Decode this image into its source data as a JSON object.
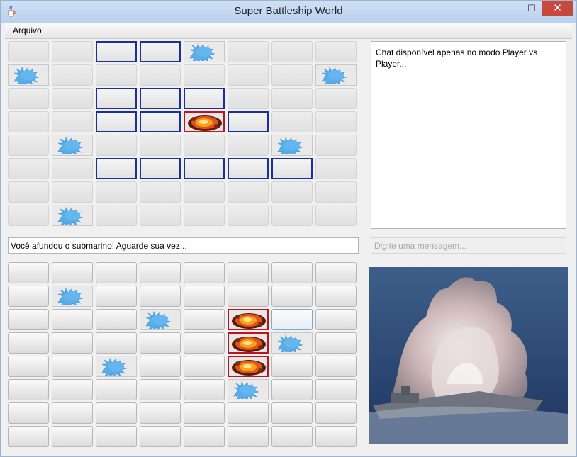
{
  "window": {
    "title": "Super Battleship World",
    "min_label": "—",
    "max_label": "☐",
    "close_label": "✕"
  },
  "menu": {
    "arquivo": "Arquivo"
  },
  "boards": [
    {
      "name": "enemy-board",
      "rows": [
        [
          "disabled",
          "disabled",
          "ship",
          "ship",
          "miss",
          "disabled",
          "disabled",
          "disabled"
        ],
        [
          "miss",
          "disabled",
          "disabled",
          "disabled",
          "disabled",
          "disabled",
          "disabled",
          "miss"
        ],
        [
          "disabled",
          "disabled",
          "ship",
          "ship",
          "ship",
          "disabled",
          "disabled",
          "disabled"
        ],
        [
          "disabled",
          "disabled",
          "ship",
          "ship",
          "hit",
          "ship",
          "disabled",
          "disabled"
        ],
        [
          "disabled",
          "miss",
          "disabled",
          "disabled",
          "disabled",
          "disabled",
          "miss",
          "disabled"
        ],
        [
          "disabled",
          "disabled",
          "ship",
          "ship",
          "ship",
          "ship",
          "ship",
          "disabled"
        ],
        [
          "disabled",
          "disabled",
          "disabled",
          "disabled",
          "disabled",
          "disabled",
          "disabled",
          "disabled"
        ],
        [
          "disabled",
          "miss",
          "disabled",
          "disabled",
          "disabled",
          "disabled",
          "disabled",
          "disabled"
        ]
      ]
    },
    {
      "name": "player-board",
      "rows": [
        [
          "empty",
          "empty",
          "empty",
          "empty",
          "empty",
          "empty",
          "empty",
          "empty"
        ],
        [
          "empty",
          "miss",
          "empty",
          "empty",
          "empty",
          "empty",
          "empty",
          "empty"
        ],
        [
          "empty",
          "empty",
          "empty",
          "miss",
          "empty",
          "hit",
          "focus",
          "empty"
        ],
        [
          "empty",
          "empty",
          "empty",
          "empty",
          "empty",
          "hit",
          "miss",
          "empty"
        ],
        [
          "empty",
          "empty",
          "miss",
          "empty",
          "empty",
          "hit",
          "empty",
          "empty"
        ],
        [
          "empty",
          "empty",
          "empty",
          "empty",
          "empty",
          "miss",
          "empty",
          "empty"
        ],
        [
          "empty",
          "empty",
          "empty",
          "empty",
          "empty",
          "empty",
          "empty",
          "empty"
        ],
        [
          "empty",
          "empty",
          "empty",
          "empty",
          "empty",
          "empty",
          "empty",
          "empty"
        ]
      ]
    }
  ],
  "status": {
    "message": "Você afundou o submarino! Aguarde sua vez..."
  },
  "chat": {
    "text": "Chat disponível apenas no modo Player vs Player...",
    "input_placeholder": "Digite uma mensagem..."
  },
  "icons": {
    "miss": "water-splash-icon",
    "hit": "explosion-icon",
    "app": "java-cup-icon"
  },
  "colors": {
    "ship_border": "#1c2f9e",
    "hit_border": "#c0141c",
    "splash": "#5aaee8",
    "close_button": "#c7493d"
  }
}
